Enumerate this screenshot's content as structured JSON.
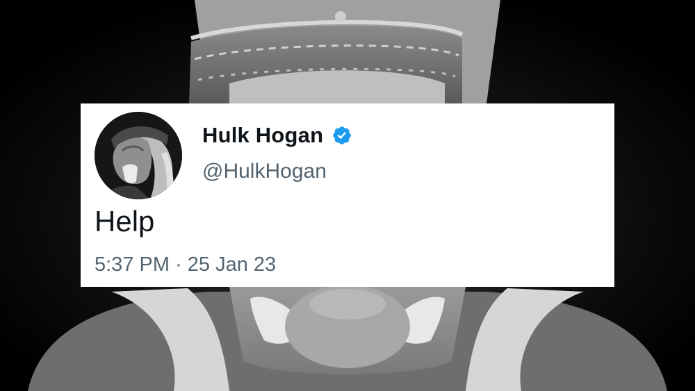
{
  "tweet": {
    "display_name": "Hulk Hogan",
    "handle": "@HulkHogan",
    "verified": true,
    "text": "Help",
    "time": "5:37 PM",
    "separator": "·",
    "date": "25 Jan 23"
  },
  "icons": {
    "avatar": "profile-photo",
    "verified": "verified-badge-icon"
  },
  "colors": {
    "card_background": "#ffffff",
    "primary_text": "#0f1419",
    "secondary_text": "#536471",
    "verified_blue": "#1d9bf0",
    "backdrop": "#000000"
  }
}
